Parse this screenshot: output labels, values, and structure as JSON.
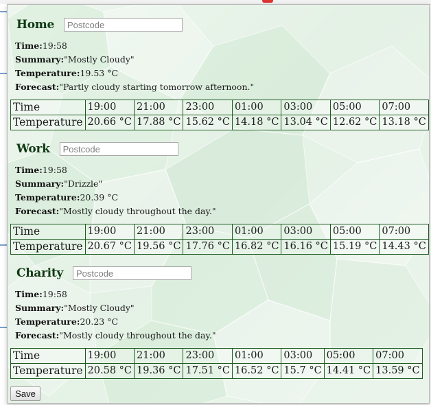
{
  "locations": [
    {
      "title": "Home",
      "postcode_placeholder": "Postcode",
      "time_label": "Time:",
      "time": "19:58",
      "summary_label": "Summary:",
      "summary": "\"Mostly Cloudy\"",
      "temperature_label": "Temperature:",
      "temperature": "19.53 °C",
      "forecast_label": "Forecast:",
      "forecast": "\"Partly cloudy starting tomorrow afternoon.\"",
      "table": {
        "time_header": "Time",
        "temp_header": "Temperature",
        "times": [
          "19:00",
          "21:00",
          "23:00",
          "01:00",
          "03:00",
          "05:00",
          "07:00"
        ],
        "temps": [
          "20.66 °C",
          "17.88 °C",
          "15.62 °C",
          "14.18 °C",
          "13.04 °C",
          "12.62 °C",
          "13.18 °C"
        ]
      }
    },
    {
      "title": "Work",
      "postcode_placeholder": "Postcode",
      "time_label": "Time:",
      "time": "19:58",
      "summary_label": "Summary:",
      "summary": "\"Drizzle\"",
      "temperature_label": "Temperature:",
      "temperature": "20.39 °C",
      "forecast_label": "Forecast:",
      "forecast": "\"Mostly cloudy throughout the day.\"",
      "table": {
        "time_header": "Time",
        "temp_header": "Temperature",
        "times": [
          "19:00",
          "21:00",
          "23:00",
          "01:00",
          "03:00",
          "05:00",
          "07:00"
        ],
        "temps": [
          "20.67 °C",
          "19.56 °C",
          "17.76 °C",
          "16.82 °C",
          "16.16 °C",
          "15.19 °C",
          "14.43 °C"
        ]
      }
    },
    {
      "title": "Charity",
      "postcode_placeholder": "Postcode",
      "time_label": "Time:",
      "time": "19:58",
      "summary_label": "Summary:",
      "summary": "\"Mostly Cloudy\"",
      "temperature_label": "Temperature:",
      "temperature": "20.23 °C",
      "forecast_label": "Forecast:",
      "forecast": "\"Mostly cloudy throughout the day.\"",
      "table": {
        "time_header": "Time",
        "temp_header": "Temperature",
        "times": [
          "19:00",
          "21:00",
          "23:00",
          "01:00",
          "03:00",
          "05:00",
          "07:00"
        ],
        "temps": [
          "20.58 °C",
          "19.36 °C",
          "17.51 °C",
          "16.52 °C",
          "15.7 °C",
          "14.41 °C",
          "13.59 °C"
        ]
      }
    }
  ],
  "save_label": "Save",
  "colors": {
    "background": "#e4f1e5",
    "title": "#0f3a12",
    "table_border": "#1e5c22"
  }
}
